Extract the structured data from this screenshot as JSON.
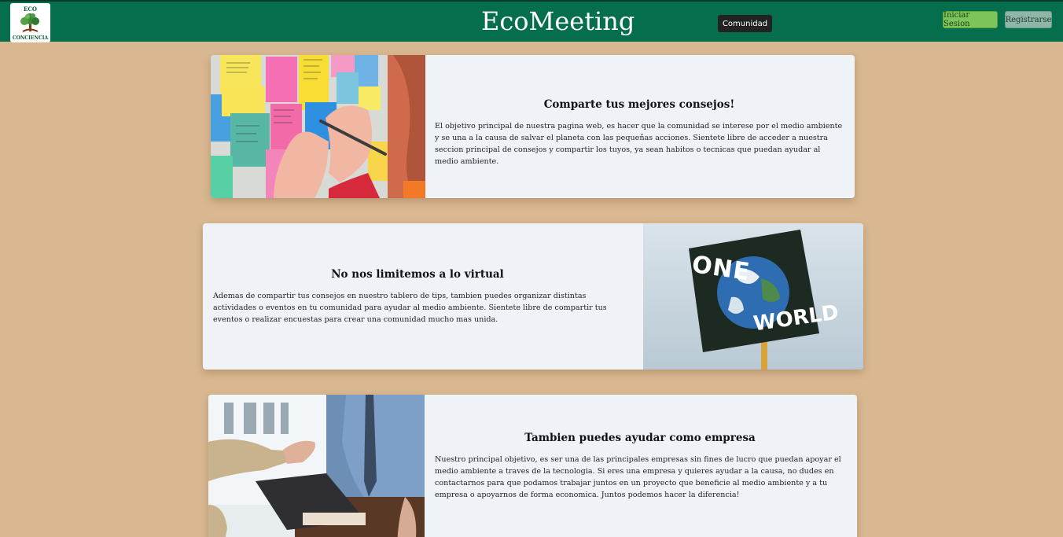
{
  "header": {
    "logo_top": "ECO",
    "logo_bottom": "CONCIENCIA",
    "title": "EcoMeeting",
    "community_label": "Comunidad",
    "login_label": "Iniciar Sesion",
    "register_label": "Registrarse"
  },
  "sections": [
    {
      "title": "Comparte tus mejores consejos!",
      "body": "El objetivo principal de nuestra pagina web, es hacer que la comunidad se interese por el medio ambiente y se una a la causa de salvar el planeta con las pequeñas acciones. Sientete libre de acceder a nuestra seccion principal de consejos y compartir los tuyos, ya sean habitos o tecnicas que puedan ayudar al medio ambiente."
    },
    {
      "title": "No nos limitemos a lo virtual",
      "body": "Ademas de compartir tus consejos en nuestro tablero de tips, tambien puedes organizar distintas actividades o eventos en tu comunidad para ayudar al medio ambiente. Sientete libre de compartir tus eventos o realizar encuestas para crear una comunidad mucho mas unida.",
      "sign_text_top": "ONE",
      "sign_text_bottom": "WORLD"
    },
    {
      "title": "Tambien puedes ayudar como empresa",
      "body": "Nuestro principal objetivo, es ser una de las principales empresas sin fines de lucro que puedan apoyar el medio ambiente a traves de la tecnologia. Si eres una empresa y quieres ayudar a la causa, no dudes en contactarnos para que podamos trabajar juntos en un proyecto que beneficie al medio ambiente y a tu empresa o apoyarnos de forma economica. Juntos podemos hacer la diferencia!"
    }
  ]
}
